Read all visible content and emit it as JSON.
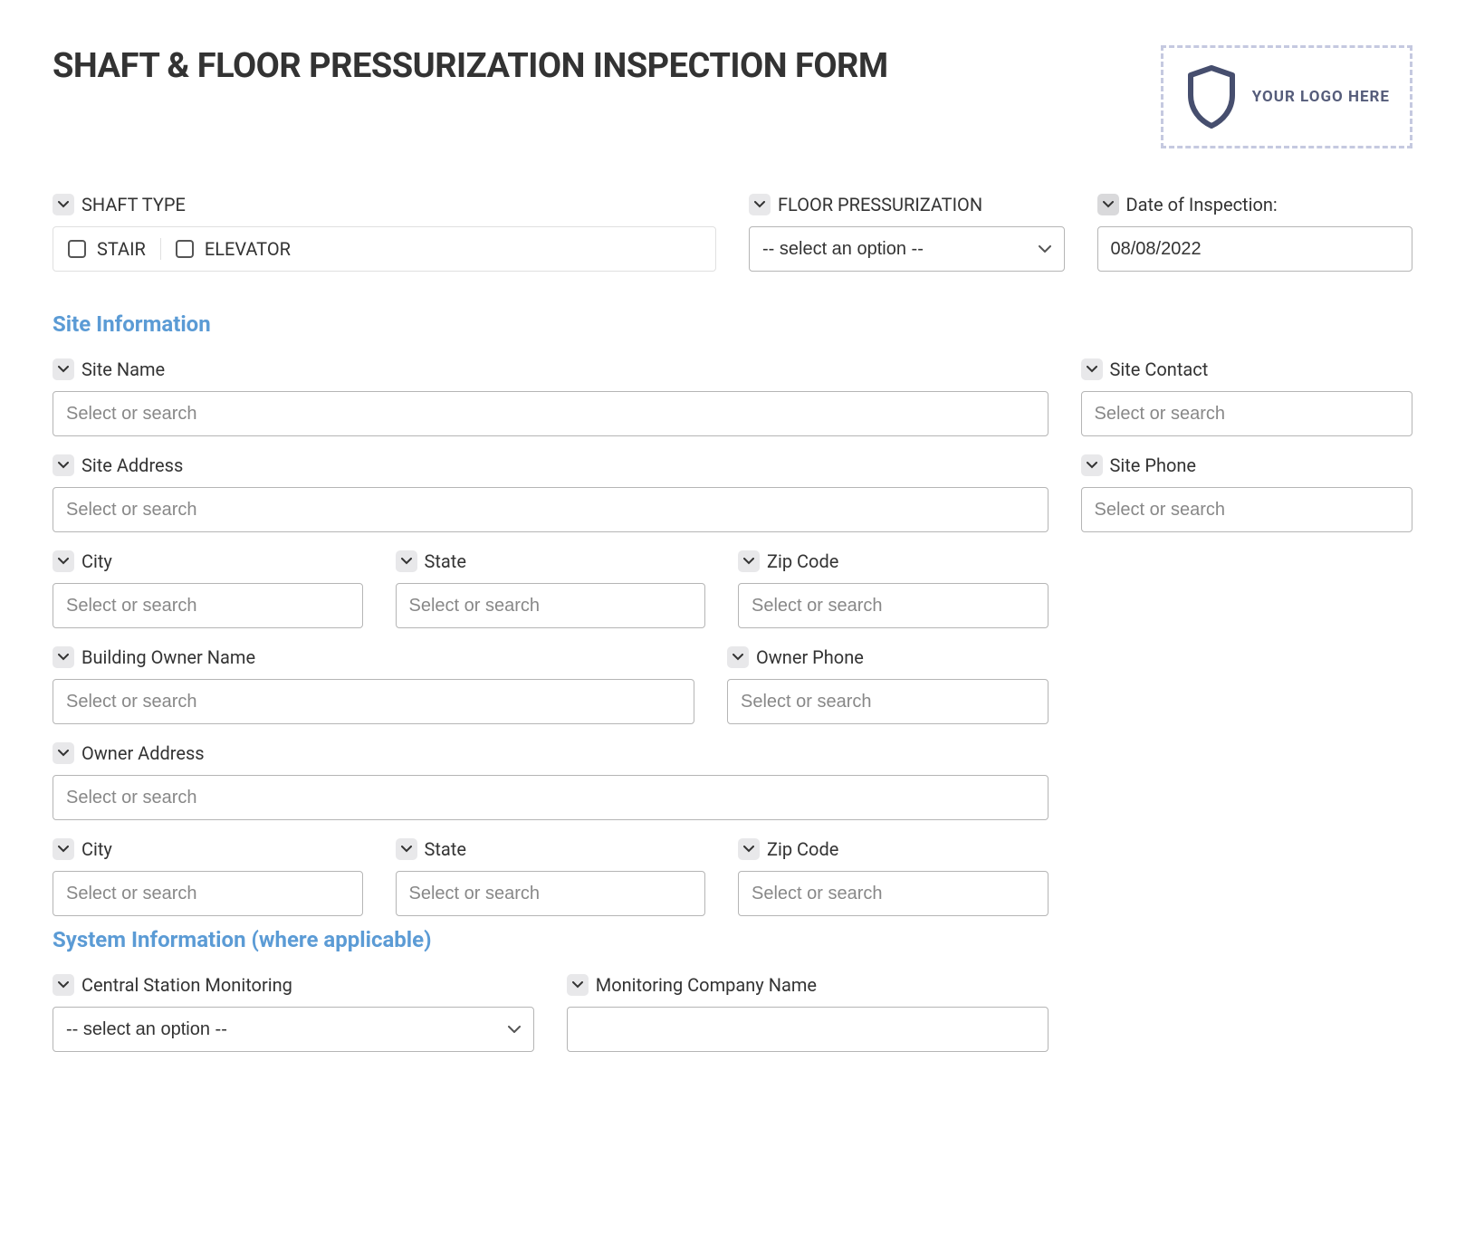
{
  "header": {
    "title": "SHAFT & FLOOR PRESSURIZATION INSPECTION FORM",
    "logo_text": "YOUR LOGO HERE"
  },
  "top": {
    "shaft_type_label": "SHAFT TYPE",
    "shaft_stair": "STAIR",
    "shaft_elevator": "ELEVATOR",
    "floor_pressurization_label": "FLOOR PRESSURIZATION",
    "floor_pressurization_selected": "-- select an option --",
    "date_label": "Date of Inspection:",
    "date_value": "08/08/2022"
  },
  "site": {
    "section_title": "Site Information",
    "placeholder": "Select or search",
    "site_name_label": "Site Name",
    "site_contact_label": "Site Contact",
    "site_address_label": "Site Address",
    "site_phone_label": "Site Phone",
    "city_label": "City",
    "state_label": "State",
    "zip_label": "Zip Code",
    "owner_name_label": "Building Owner Name",
    "owner_phone_label": "Owner Phone",
    "owner_address_label": "Owner Address",
    "owner_city_label": "City",
    "owner_state_label": "State",
    "owner_zip_label": "Zip Code"
  },
  "system": {
    "section_title": "System Information (where applicable)",
    "central_station_label": "Central Station Monitoring",
    "central_station_selected": "-- select an option --",
    "monitoring_company_label": "Monitoring Company Name"
  }
}
